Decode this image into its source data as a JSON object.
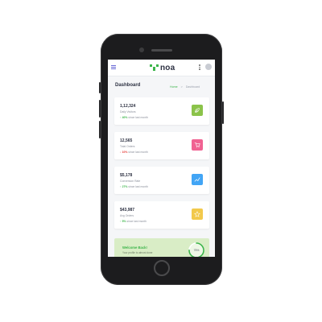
{
  "app": {
    "name": "noa",
    "brand_color": "#3cb54a"
  },
  "header": {
    "menu_icon": "menu-icon",
    "kebab_icon": "kebab-icon",
    "profile_icon": "user-icon"
  },
  "page": {
    "title": "Dashboard",
    "breadcrumb": [
      "Home",
      "Dashboard"
    ],
    "breadcrumb_separator": ">"
  },
  "stats": [
    {
      "value": "1,12,324",
      "label": "Daily Visitors",
      "change": "40%",
      "direction": "up",
      "since": "since last month",
      "icon": "leaf-icon",
      "color": "#8bc34a"
    },
    {
      "value": "12,565",
      "label": "Total Orders",
      "change": "10%",
      "direction": "down",
      "since": "since last month",
      "icon": "cart-icon",
      "color": "#f06292"
    },
    {
      "value": "$5,178",
      "label": "Conversion Rate",
      "change": "27%",
      "direction": "up",
      "since": "since last month",
      "icon": "chart-icon",
      "color": "#42a5f5"
    },
    {
      "value": "$43,987",
      "label": "Avg Orders",
      "change": "5%",
      "direction": "up",
      "since": "since last month",
      "icon": "star-icon",
      "color": "#f2c94c"
    }
  ],
  "welcome": {
    "title": "Welcome Back!",
    "subtitle": "Your profile is almost done",
    "progress_text": "75%",
    "progress": 0.75
  },
  "status_colors": {
    "up": "#3cb54a",
    "down": "#e53935"
  }
}
